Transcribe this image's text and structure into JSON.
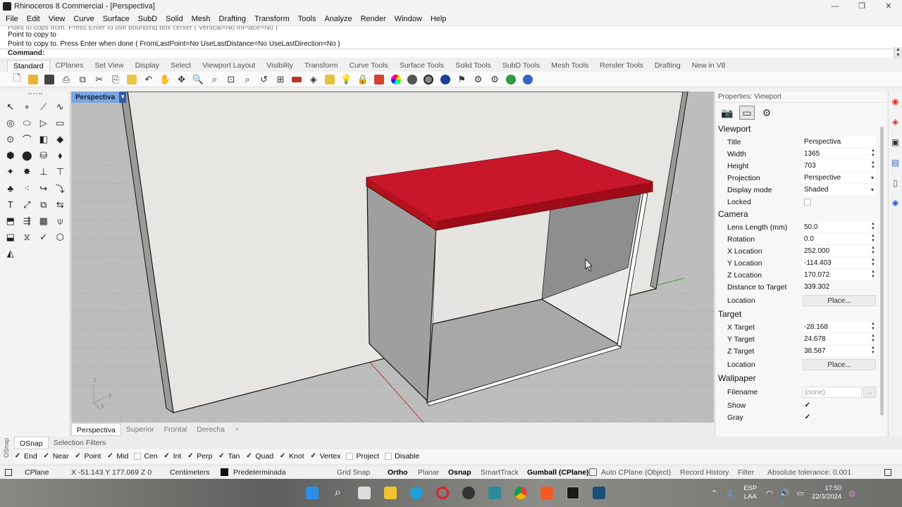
{
  "window": {
    "title": "Rhinoceros 8 Commercial - [Perspectiva]",
    "controls": [
      "—",
      "❐",
      "✕"
    ]
  },
  "menu": [
    "File",
    "Edit",
    "View",
    "Curve",
    "Surface",
    "SubD",
    "Solid",
    "Mesh",
    "Drafting",
    "Transform",
    "Tools",
    "Analyze",
    "Render",
    "Window",
    "Help"
  ],
  "command_history": {
    "partial_line": "Point to copy from. Press Enter to use bounding box center ( Vertical=No  InPlace=No )",
    "line1": "Point to copy to",
    "line2": "Point to copy to. Press Enter when done ( FromLastPoint=No  UseLastDistance=No  UseLastDirection=No )",
    "prompt": "Command:"
  },
  "toolbar_tabs": [
    "Standard",
    "CPlanes",
    "Set View",
    "Display",
    "Select",
    "Viewport Layout",
    "Visibility",
    "Transform",
    "Curve Tools",
    "Surface Tools",
    "Solid Tools",
    "SubD Tools",
    "Mesh Tools",
    "Render Tools",
    "Drafting",
    "New in V8"
  ],
  "toolbar_icons": [
    "new-file-icon",
    "open-icon",
    "save-icon",
    "print-icon",
    "export-icon",
    "cut-icon",
    "copy-icon",
    "paste-icon",
    "undo-icon",
    "pan-icon",
    "rotate-view-icon",
    "zoom-dynamic-icon",
    "zoom-window-icon",
    "zoom-extents-icon",
    "zoom-selected-icon",
    "undo-view-icon",
    "four-viewports-icon",
    "car-icon",
    "hide-icon",
    "transform-icon",
    "light-icon",
    "lock-icon",
    "paint-icon",
    "color-wheel-icon",
    "sphere-grey-icon",
    "texture-icon",
    "sphere-blue-icon",
    "flag-icon",
    "settings-icon",
    "gear-icon",
    "globe-icon",
    "help-icon"
  ],
  "viewport": {
    "label": "Perspectiva",
    "tabs": [
      "Perspectiva",
      "Superior",
      "Frontal",
      "Derecha"
    ],
    "add_tab": "+",
    "axis_labels": {
      "z": "z",
      "y": "y",
      "x": "x"
    }
  },
  "properties": {
    "header": "Properties: Viewport",
    "sections": {
      "viewport": "Viewport",
      "camera": "Camera",
      "target": "Target",
      "wallpaper": "Wallpaper"
    },
    "viewport_rows": {
      "title": {
        "label": "Title",
        "value": "Perspectiva"
      },
      "width": {
        "label": "Width",
        "value": "1365"
      },
      "height": {
        "label": "Height",
        "value": "703"
      },
      "projection": {
        "label": "Projection",
        "value": "Perspective"
      },
      "display_mode": {
        "label": "Display mode",
        "value": "Shaded"
      },
      "locked": {
        "label": "Locked",
        "value": false
      }
    },
    "camera_rows": {
      "lens": {
        "label": "Lens Length (mm)",
        "value": "50.0"
      },
      "rotation": {
        "label": "Rotation",
        "value": "0.0"
      },
      "x": {
        "label": "X Location",
        "value": "252.000"
      },
      "y": {
        "label": "Y Location",
        "value": "-114.403"
      },
      "z": {
        "label": "Z Location",
        "value": "170.072"
      },
      "distance": {
        "label": "Distance to Target",
        "value": "339.302"
      },
      "location": {
        "label": "Location",
        "button": "Place..."
      }
    },
    "target_rows": {
      "x": {
        "label": "X Target",
        "value": "-28.168"
      },
      "y": {
        "label": "Y Target",
        "value": "24.678"
      },
      "z": {
        "label": "Z Target",
        "value": "38.587"
      },
      "location": {
        "label": "Location",
        "button": "Place..."
      }
    },
    "wallpaper_rows": {
      "filename": {
        "label": "Filename",
        "value": "(none)",
        "browse": "..."
      },
      "show": {
        "label": "Show",
        "value": true
      },
      "gray": {
        "label": "Gray",
        "value": true
      }
    }
  },
  "osnap": {
    "side_label": "OSnap",
    "tabs": [
      "OSnap",
      "Selection Filters"
    ],
    "items": [
      {
        "label": "End",
        "checked": true
      },
      {
        "label": "Near",
        "checked": true
      },
      {
        "label": "Point",
        "checked": true
      },
      {
        "label": "Mid",
        "checked": true
      },
      {
        "label": "Cen",
        "checked": false
      },
      {
        "label": "Int",
        "checked": true
      },
      {
        "label": "Perp",
        "checked": true
      },
      {
        "label": "Tan",
        "checked": true
      },
      {
        "label": "Quad",
        "checked": true
      },
      {
        "label": "Knot",
        "checked": true
      },
      {
        "label": "Vertex",
        "checked": true
      },
      {
        "label": "Project",
        "checked": false
      },
      {
        "label": "Disable",
        "checked": false
      }
    ]
  },
  "status": {
    "cplane": "CPlane",
    "coords": "X -51.143 Y 177.069 Z 0",
    "units": "Centimeters",
    "layer": "Predeterminada",
    "grid_snap": "Grid Snap",
    "ortho": "Ortho",
    "planar": "Planar",
    "osnap": "Osnap",
    "smarttrack": "SmartTrack",
    "gumball": "Gumball (CPlane)",
    "auto_cplane": "Auto CPlane (Object)",
    "record_history": "Record History",
    "filter": "Filter",
    "tolerance": "Absolute tolerance: 0.001"
  },
  "taskbar": {
    "apps": [
      "windows-start-icon",
      "search-icon",
      "task-view-icon",
      "file-explorer-icon",
      "edge-icon",
      "opera-icon",
      "app-icon",
      "app3-icon",
      "chrome-icon",
      "brave-icon",
      "rhino-icon",
      "terminal-icon"
    ],
    "lang_top": "ESP",
    "lang_bottom": "LAA",
    "time": "17:50",
    "date": "22/3/2024"
  },
  "colors": {
    "tabletop": "#b3111d",
    "viewport_label_bg": "#7ba6e0",
    "grid_bg": "#bdbdbd"
  }
}
